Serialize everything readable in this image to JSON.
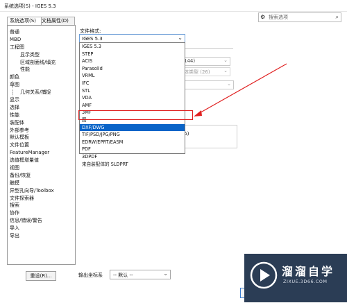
{
  "window": {
    "title": "系统选项(S) - IGES 5.3"
  },
  "tabs": [
    {
      "label": "系统选项(S)"
    },
    {
      "label": "文档属性(D)"
    }
  ],
  "search": {
    "label": "搜索选项"
  },
  "tree": {
    "items": [
      "普通",
      "MBD",
      "工程图",
      "显示类型",
      "区域剖面线/填充",
      "性能",
      "颜色",
      "草图",
      "几何关系/捕捉",
      "显示",
      "选择",
      "性能",
      "装配体",
      "外部参考",
      "默认模板",
      "文件位置",
      "FeatureManager",
      "选值框增量值",
      "视图",
      "备份/恢复",
      "触摸",
      "异型孔向导/Toolbox",
      "文件探索器",
      "搜索",
      "协作",
      "信息/错误/警告",
      "导入",
      "导出"
    ]
  },
  "reset_button": {
    "label": "重设(R)..."
  },
  "file_format": {
    "label": "文件格式:",
    "selected": "IGES 5.3"
  },
  "format_options": [
    "IGES 5.3",
    "STEP",
    "ACIS",
    "Parasolid",
    "VRML",
    "IFC",
    "STL",
    "VDA",
    "AMF",
    "3MF",
    "图",
    "DXF/DWG",
    "TIF/PSD/JPG/PNG",
    "EDRW/EPRT/EASM",
    "PDF",
    "3DPDF",
    "来自装配体的 SLDPRT"
  ],
  "selected_option": "DXF/DWG",
  "background_fields": {
    "field1_value": "144)",
    "field2_value": "体类型 (26)",
    "text_fragment": "A)"
  },
  "coord": {
    "label": "输出坐标系",
    "value": "-- 默认 --"
  },
  "watermark": {
    "name": "溜溜自学",
    "url": "ZIXUE.3D66.COM"
  },
  "colors": {
    "selection": "#0a64c8",
    "annotation_red": "#e02020",
    "watermark_bg": "#2b3d55"
  }
}
